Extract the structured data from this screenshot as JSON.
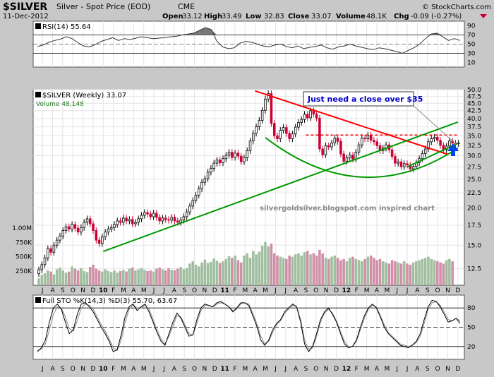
{
  "header": {
    "symbol": "$SILVER",
    "name": "Silver - Spot Price (EOD)",
    "exchange": "CME",
    "date": "11-Dec-2012",
    "watermark": "© StockCharts.com",
    "open_label": "Open",
    "open": "33.12",
    "high_label": "High",
    "high": "33.49",
    "low_label": "Low",
    "low": "32.83",
    "close_label": "Close",
    "close": "33.07",
    "volume_label": "Volume",
    "volume": "48.1K",
    "chg_label": "Chg",
    "chg": "-0.09 (-0.27%)"
  },
  "colors": {
    "background": "#c8c8c8",
    "panel": "#ffffff",
    "up_bar": "#000000",
    "down_bar": "#cc0033",
    "volume_up": "#a0bfa0",
    "volume_down": "#d090a8",
    "trendline": "#009900",
    "resistance_line": "#ff0000",
    "annotation_text": "#0000cc",
    "arrow": "#0044ee"
  },
  "months": [
    "J",
    "A",
    "S",
    "O",
    "N",
    "D",
    "10",
    "F",
    "M",
    "A",
    "M",
    "J",
    "J",
    "A",
    "S",
    "O",
    "N",
    "D",
    "11",
    "F",
    "M",
    "A",
    "M",
    "J",
    "J",
    "A",
    "S",
    "O",
    "N",
    "D",
    "12",
    "F",
    "M",
    "A",
    "M",
    "J",
    "J",
    "A",
    "S",
    "O",
    "N",
    "D"
  ],
  "chart_data": [
    {
      "panel": "rsi",
      "type": "line",
      "title": "RSI(14) 55.64",
      "y_ticks": [
        "90",
        "70",
        "50",
        "30",
        "10"
      ],
      "ylim": [
        0,
        100
      ],
      "levels": [
        70,
        30
      ],
      "series": [
        {
          "name": "RSI(14)",
          "values": [
            45,
            48,
            54,
            58,
            61,
            66,
            62,
            53,
            46,
            44,
            49,
            56,
            60,
            64,
            58,
            62,
            60,
            63,
            66,
            64,
            62,
            63,
            64,
            66,
            67,
            70,
            72,
            74,
            80,
            86,
            82,
            56,
            44,
            40,
            42,
            52,
            56,
            54,
            50,
            46,
            44,
            48,
            50,
            45,
            42,
            46,
            40,
            43,
            45,
            48,
            42,
            39,
            44,
            46,
            50,
            46,
            43,
            40,
            38,
            42,
            40,
            37,
            34,
            30,
            36,
            42,
            50,
            62,
            72,
            74,
            66,
            58,
            62,
            58
          ]
        }
      ]
    },
    {
      "panel": "price",
      "type": "candlestick",
      "title": "$SILVER (Weekly) 33.07",
      "legend_volume": "Volume 48,148",
      "x_range": [
        "2009-07",
        "2012-12"
      ],
      "ylim": [
        11,
        50
      ],
      "y_scale": "log",
      "y_ticks": [
        "50.0",
        "47.5",
        "45.0",
        "42.5",
        "40.0",
        "37.5",
        "35.0",
        "32.5",
        "30.0",
        "27.5",
        "25.0",
        "22.5",
        "20.0",
        "17.5",
        "15.0",
        "12.5"
      ],
      "volume_ticks": [
        "1.00M",
        "750K",
        "500K",
        "250K"
      ],
      "closes": [
        12.4,
        12.9,
        13.6,
        14.6,
        14.2,
        15.0,
        15.6,
        16.1,
        16.8,
        17.3,
        17.0,
        17.6,
        17.1,
        16.6,
        17.2,
        17.9,
        18.4,
        17.7,
        16.8,
        15.6,
        15.2,
        16.0,
        16.6,
        17.0,
        17.2,
        17.6,
        18.1,
        17.9,
        18.5,
        18.1,
        18.3,
        17.7,
        17.9,
        18.4,
        18.9,
        19.3,
        19.1,
        18.7,
        19.2,
        18.6,
        18.1,
        18.5,
        18.3,
        18.2,
        18.6,
        18.1,
        17.9,
        18.2,
        18.7,
        19.4,
        20.3,
        21.2,
        22.1,
        23.2,
        24.4,
        25.1,
        26.4,
        27.2,
        28.3,
        29.0,
        28.4,
        29.3,
        30.1,
        30.8,
        29.6,
        30.6,
        29.9,
        28.6,
        29.5,
        31.2,
        33.6,
        35.7,
        37.5,
        39.4,
        42.6,
        46.5,
        48.5,
        38.5,
        35.0,
        34.2,
        36.5,
        37.3,
        35.6,
        34.2,
        35.5,
        37.4,
        38.8,
        39.7,
        41.3,
        40.2,
        42.5,
        41.4,
        40.1,
        31.6,
        30.2,
        32.4,
        32.1,
        33.1,
        34.4,
        33.5,
        30.4,
        28.7,
        29.5,
        30.1,
        29.2,
        30.8,
        32.6,
        34.4,
        34.2,
        35.2,
        33.8,
        33.4,
        32.4,
        31.2,
        31.8,
        32.6,
        31.4,
        29.8,
        28.3,
        28.6,
        27.5,
        28.2,
        27.9,
        27.1,
        27.6,
        28.4,
        29.3,
        30.5,
        31.6,
        33.4,
        34.2,
        34.6,
        33.8,
        32.5,
        31.4,
        32.3,
        33.6,
        33.1,
        32.9,
        33.07
      ],
      "volume_values_k": [
        120,
        180,
        210,
        260,
        240,
        190,
        280,
        310,
        260,
        220,
        240,
        330,
        290,
        260,
        300,
        250,
        230,
        320,
        360,
        290,
        260,
        240,
        280,
        250,
        230,
        260,
        220,
        250,
        270,
        240,
        290,
        310,
        260,
        280,
        300,
        270,
        250,
        260,
        240,
        290,
        310,
        280,
        260,
        300,
        270,
        260,
        290,
        320,
        280,
        300,
        380,
        420,
        360,
        330,
        400,
        450,
        390,
        410,
        470,
        430,
        390,
        420,
        460,
        510,
        480,
        520,
        440,
        400,
        520,
        560,
        480,
        600,
        540,
        590,
        690,
        760,
        680,
        730,
        560,
        520,
        500,
        480,
        460,
        520,
        500,
        540,
        560,
        520,
        580,
        600,
        540,
        560,
        520,
        620,
        560,
        480,
        460,
        500,
        520,
        480,
        440,
        460,
        420,
        480,
        500,
        460,
        440,
        420,
        460,
        500,
        520,
        480,
        440,
        460,
        420,
        400,
        380,
        440,
        420,
        400,
        380,
        420,
        380,
        360,
        400,
        420,
        440,
        460,
        480,
        500,
        460,
        440,
        420,
        400,
        380,
        440,
        460,
        420
      ],
      "annotations": {
        "callout": "Just need a close over $35",
        "credit": "silvergoldsilver.blogspot.com inspired chart"
      },
      "lines": [
        {
          "name": "resistance",
          "style": "solid",
          "from": [
            "2011-04",
            49.5
          ],
          "to": [
            "2012-11",
            30.3
          ]
        },
        {
          "name": "horizontal",
          "style": "dashed",
          "from": [
            "2011-09",
            35.2
          ],
          "to": [
            "2012-12",
            35.2
          ]
        },
        {
          "name": "support",
          "style": "solid",
          "from": [
            "2010-01",
            14.3
          ],
          "to": [
            "2012-12",
            38.9
          ]
        },
        {
          "name": "upper_support",
          "style": "solid",
          "from": [
            "2012-07",
            27.5
          ],
          "to": [
            "2012-12",
            33.0
          ]
        },
        {
          "name": "arc",
          "style": "curve",
          "from": [
            "2011-05",
            34.5
          ],
          "to": [
            "2012-12",
            31.8
          ]
        }
      ]
    },
    {
      "panel": "stochastic",
      "type": "line",
      "title": "Full STO %K(14,3) %D(3) 55.70, 63.67",
      "y_ticks": [
        "80",
        "50",
        "20"
      ],
      "ylim": [
        0,
        100
      ],
      "levels": [
        80,
        50,
        20
      ],
      "series": [
        {
          "name": "%K(14,3)",
          "values": [
            12,
            18,
            30,
            58,
            80,
            86,
            78,
            58,
            40,
            46,
            70,
            86,
            88,
            82,
            74,
            62,
            50,
            40,
            28,
            12,
            15,
            38,
            66,
            82,
            86,
            76,
            82,
            86,
            74,
            58,
            42,
            28,
            22,
            40,
            58,
            72,
            64,
            50,
            36,
            38,
            62,
            80,
            86,
            84,
            82,
            88,
            90,
            86,
            82,
            74,
            80,
            88,
            88,
            84,
            68,
            52,
            30,
            22,
            30,
            46,
            56,
            62,
            74,
            80,
            86,
            82,
            58,
            24,
            12,
            20,
            40,
            62,
            74,
            80,
            70,
            58,
            40,
            24,
            18,
            20,
            30,
            50,
            68,
            80,
            86,
            80,
            66,
            50,
            40,
            34,
            28,
            22,
            20,
            18,
            22,
            28,
            40,
            62,
            82,
            92,
            90,
            82,
            70,
            58,
            60,
            64,
            56
          ]
        },
        {
          "name": "%D(3)",
          "values": [
            14,
            16,
            24,
            46,
            70,
            82,
            80,
            66,
            48,
            44,
            60,
            80,
            86,
            84,
            78,
            66,
            54,
            44,
            32,
            18,
            14,
            30,
            58,
            78,
            84,
            80,
            80,
            84,
            78,
            62,
            46,
            32,
            24,
            36,
            52,
            68,
            66,
            54,
            40,
            38,
            56,
            76,
            84,
            84,
            82,
            86,
            88,
            86,
            82,
            76,
            78,
            86,
            88,
            86,
            72,
            56,
            36,
            24,
            28,
            42,
            54,
            60,
            72,
            78,
            84,
            82,
            62,
            30,
            16,
            18,
            36,
            58,
            72,
            78,
            72,
            60,
            44,
            28,
            20,
            20,
            28,
            46,
            64,
            78,
            84,
            82,
            68,
            54,
            42,
            36,
            30,
            24,
            22,
            20,
            22,
            26,
            36,
            56,
            78,
            88,
            90,
            84,
            74,
            62,
            60,
            64,
            60
          ]
        }
      ]
    }
  ]
}
